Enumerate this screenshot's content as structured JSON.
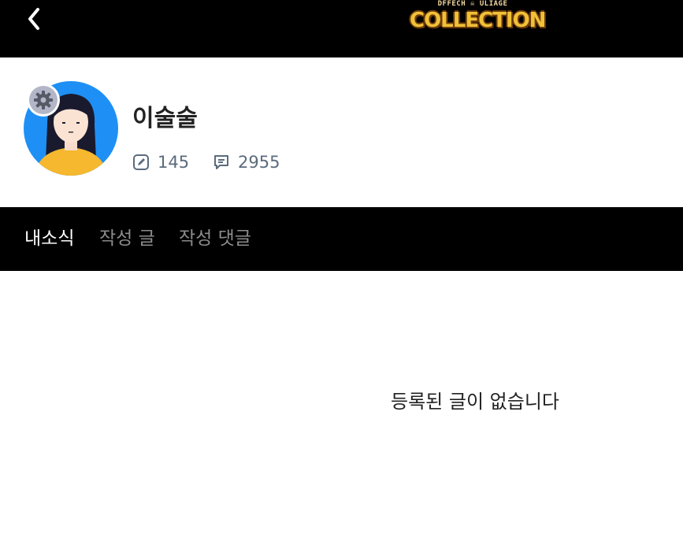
{
  "header": {
    "back_icon": "chevron-left-icon",
    "logo_top_text": "DFFECH ☠ ULIAGE",
    "logo_main_text": "COLLECTION"
  },
  "profile": {
    "username": "이술술",
    "settings_icon": "gear-icon",
    "avatar_icon": "user-avatar",
    "posts_icon": "edit-icon",
    "posts_count": "145",
    "comments_icon": "comment-icon",
    "comments_count": "2955"
  },
  "tabs": [
    {
      "label": "내소식",
      "active": true
    },
    {
      "label": "작성 글",
      "active": false
    },
    {
      "label": "작성 댓글",
      "active": false
    }
  ],
  "content": {
    "empty_message": "등록된 글이 없습니다"
  },
  "colors": {
    "header_bg": "#000000",
    "avatar_bg": "#1e90f5",
    "tab_active": "#ffffff",
    "tab_inactive": "#8c8c8c",
    "stat_text": "#5b6b7d"
  }
}
